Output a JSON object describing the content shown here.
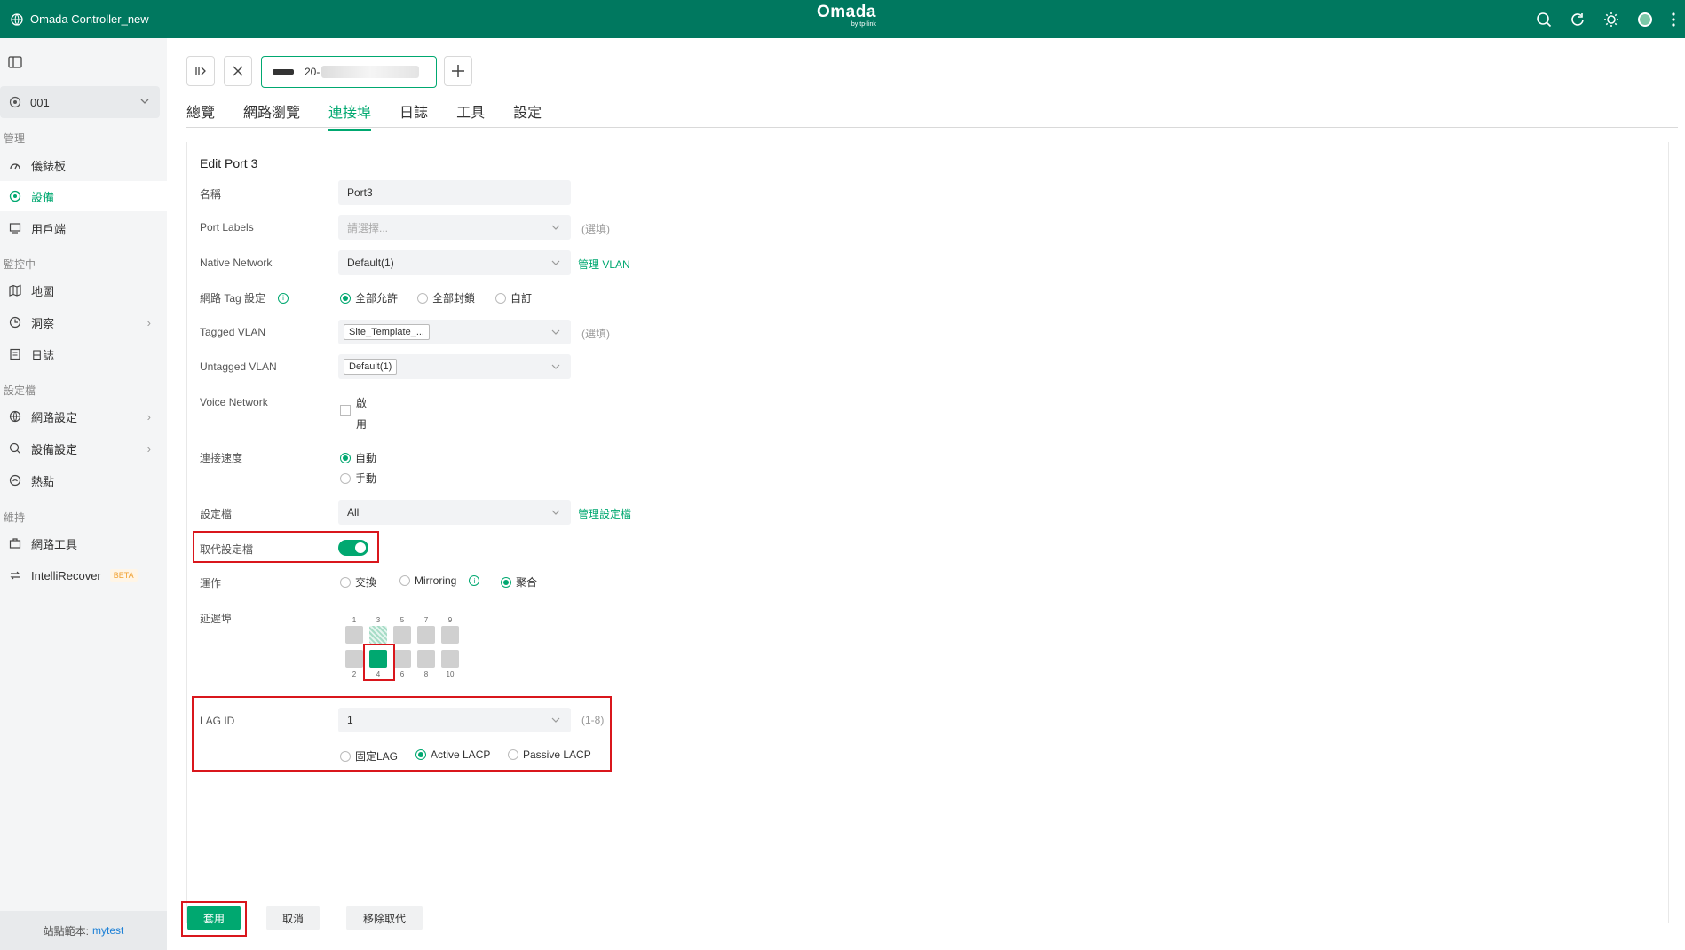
{
  "topbar": {
    "controller_name": "Omada Controller_new",
    "brand": "Omada",
    "brand_sub": "by tp-link"
  },
  "sidebar": {
    "site": "001",
    "sections": {
      "manage": "管理",
      "monitor": "監控中",
      "config": "設定檔",
      "maintain": "維持"
    },
    "items": [
      {
        "label": "儀錶板"
      },
      {
        "label": "設備"
      },
      {
        "label": "用戶端"
      },
      {
        "label": "地圖"
      },
      {
        "label": "洞察"
      },
      {
        "label": "日誌"
      },
      {
        "label": "網路設定"
      },
      {
        "label": "設備設定"
      },
      {
        "label": "熱點"
      },
      {
        "label": "網路工具"
      },
      {
        "label": "IntelliRecover"
      }
    ],
    "beta": "BETA",
    "footer_label": "站點範本:",
    "footer_link": "mytest"
  },
  "device_tab": {
    "name_prefix": "20-"
  },
  "tabs": [
    "總覽",
    "網路瀏覽",
    "連接埠",
    "日誌",
    "工具",
    "設定"
  ],
  "form": {
    "title": "Edit Port 3",
    "name_label": "名稱",
    "name_value": "Port3",
    "port_labels_label": "Port Labels",
    "port_labels_placeholder": "請選擇...",
    "optional": "(選填)",
    "native_label": "Native Network",
    "native_value": "Default(1)",
    "manage_vlan": "管理 VLAN",
    "tag_label": "網路 Tag 設定",
    "tag_opt1": "全部允許",
    "tag_opt2": "全部封鎖",
    "tag_opt3": "自訂",
    "tagged_label": "Tagged VLAN",
    "tagged_value": "Site_Template_...",
    "untagged_label": "Untagged VLAN",
    "untagged_value": "Default(1)",
    "voice_label": "Voice Network",
    "voice_text1": "啟",
    "voice_text2": "用",
    "speed_label": "連接速度",
    "speed_auto": "自動",
    "speed_manual": "手動",
    "profile_label": "設定檔",
    "profile_value": "All",
    "manage_profile": "管理設定檔",
    "override_label": "取代設定檔",
    "op_label": "運作",
    "op_switch": "交換",
    "op_mirror": "Mirroring",
    "op_agg": "聚合",
    "ports_label": "延遲埠",
    "top_ports": [
      "1",
      "3",
      "5",
      "7",
      "9"
    ],
    "bottom_ports": [
      "2",
      "4",
      "6",
      "8",
      "10"
    ],
    "lag_label": "LAG ID",
    "lag_value": "1",
    "lag_range": "(1-8)",
    "lag_static": "固定LAG",
    "lag_active": "Active LACP",
    "lag_passive": "Passive LACP"
  },
  "buttons": {
    "apply": "套用",
    "cancel": "取消",
    "remove": "移除取代"
  },
  "colors": {
    "brand": "#00785f",
    "accent": "#00a870",
    "highlight": "#d9161c"
  }
}
